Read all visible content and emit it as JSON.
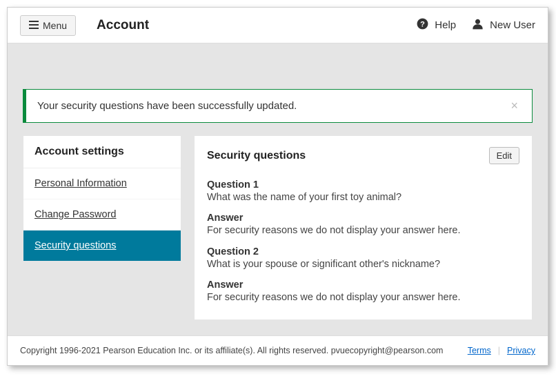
{
  "header": {
    "menu_label": "Menu",
    "title": "Account",
    "help_label": "Help",
    "user_label": "New User"
  },
  "alert": {
    "text": "Your security questions have been successfully updated."
  },
  "sidebar": {
    "title": "Account settings",
    "items": [
      {
        "label": "Personal Information"
      },
      {
        "label": "Change Password"
      },
      {
        "label": "Security questions"
      }
    ]
  },
  "content": {
    "title": "Security questions",
    "edit_label": "Edit",
    "q1_label": "Question 1",
    "q1_text": "What was the name of your first toy animal?",
    "a1_label": "Answer",
    "a1_text": "For security reasons we do not display your answer here.",
    "q2_label": "Question 2",
    "q2_text": "What is your spouse or significant other's nickname?",
    "a2_label": "Answer",
    "a2_text": "For security reasons we do not display your answer here."
  },
  "footer": {
    "copyright": "Copyright 1996-2021 Pearson Education Inc. or its affiliate(s). All rights reserved. pvuecopyright@pearson.com",
    "terms_label": "Terms",
    "privacy_label": "Privacy"
  }
}
